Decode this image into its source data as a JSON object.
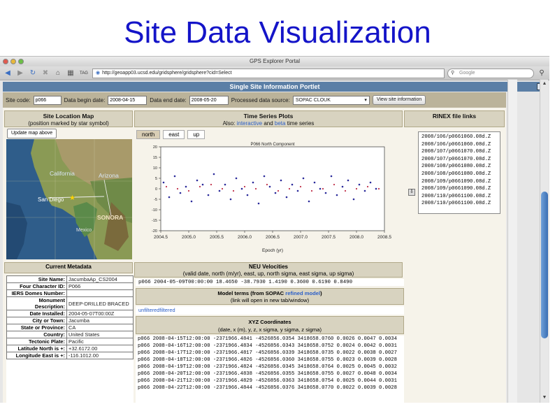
{
  "slide": {
    "title": "Site Data Visualization"
  },
  "browser": {
    "window_title": "GPS Explorer Portal",
    "url_prefix": "TAG",
    "url": "http://geoapp03.ucsd.edu/gridsphere/gridsphere?cid=Select",
    "search_placeholder": "Google"
  },
  "portlet": {
    "title": "Single Site Information Portlet"
  },
  "form": {
    "site_code_label": "Site code:",
    "site_code": "p066",
    "begin_label": "Data begin date:",
    "begin_date": "2008-04-15",
    "end_label": "Data end date:",
    "end_date": "2008-05-20",
    "source_label": "Processed data source:",
    "source": "SOPAC CLOUK",
    "view_button": "View site information"
  },
  "map_panel": {
    "title": "Site Location Map",
    "subtitle": "(position marked by star symbol)",
    "update_button": "Update map above",
    "labels": {
      "california": "California",
      "arizona": "Arizona",
      "san_diego": "San Diego",
      "sonora": "SONORA",
      "mexico": "Mexico"
    }
  },
  "ts_panel": {
    "title": "Time Series Plots",
    "also": "Also:",
    "interactive": "interactive",
    "and": "and",
    "beta": "beta",
    "time_series": "time series",
    "tabs": [
      "north",
      "east",
      "up"
    ]
  },
  "chart_data": {
    "type": "scatter",
    "x_ticks": [
      "2004.5",
      "2005.0",
      "2005.5",
      "2006.0",
      "2006.5",
      "2007.0",
      "2007.5",
      "2008.0",
      "2008.5"
    ],
    "y_ticks": [
      "20",
      "15",
      "10",
      "5",
      "0",
      "-5",
      "-10",
      "-15",
      "-20"
    ],
    "xlim": [
      2004.5,
      2008.5
    ],
    "ylim": [
      -20,
      20
    ],
    "title": "P066 North Component",
    "xlabel": "Epoch (yr)",
    "ylabel": "",
    "series": [
      {
        "color": "#2a2a9a",
        "x": [
          2004.55,
          2004.65,
          2004.75,
          2004.85,
          2004.95,
          2005.05,
          2005.15,
          2005.25,
          2005.35,
          2005.45,
          2005.55,
          2005.65,
          2005.75,
          2005.85,
          2005.95,
          2006.05,
          2006.15,
          2006.25,
          2006.35,
          2006.45,
          2006.55,
          2006.65,
          2006.75,
          2006.85,
          2006.95,
          2007.05,
          2007.15,
          2007.25,
          2007.35,
          2007.45,
          2007.55,
          2007.65,
          2007.75,
          2007.85,
          2007.95,
          2008.05,
          2008.15,
          2008.25,
          2008.35
        ],
        "y": [
          3,
          -4,
          6,
          -2,
          1,
          -6,
          4,
          2,
          -3,
          7,
          -1,
          2,
          -5,
          5,
          0,
          -3,
          3,
          -7,
          6,
          1,
          -2,
          4,
          -4,
          2,
          -1,
          5,
          -6,
          3,
          0,
          -2,
          6,
          -3,
          1,
          4,
          -5,
          2,
          -1,
          3,
          0
        ]
      },
      {
        "color": "#c0304a",
        "x": [
          2004.6,
          2004.8,
          2005.0,
          2005.2,
          2005.4,
          2005.6,
          2005.8,
          2006.0,
          2006.2,
          2006.4,
          2006.6,
          2006.8,
          2007.0,
          2007.2,
          2007.4,
          2007.6,
          2007.8,
          2008.0,
          2008.2,
          2008.4
        ],
        "y": [
          1,
          0,
          -1,
          1,
          2,
          0,
          -1,
          1,
          0,
          2,
          -1,
          0,
          1,
          -1,
          0,
          2,
          -1,
          0,
          1,
          0
        ]
      }
    ]
  },
  "rinex_panel": {
    "title": "RINEX file links",
    "files": [
      "2008/106/p0661060.08d.Z",
      "2008/106/p0661060.08d.Z",
      "2008/107/p0661070.08d.Z",
      "2008/107/p0661070.08d.Z",
      "2008/108/p0661080.08d.Z",
      "2008/108/p0661080.08d.Z",
      "2008/109/p0661090.08d.Z",
      "2008/109/p0661090.08d.Z",
      "2008/110/p0661100.08d.Z",
      "2008/110/p0661100.08d.Z"
    ]
  },
  "metadata": {
    "title": "Current Metadata",
    "rows": [
      {
        "k": "Site Name:",
        "v": "JacumbaAp_CS2004"
      },
      {
        "k": "Four Character ID:",
        "v": "P066"
      },
      {
        "k": "IERS Domes Number:",
        "v": ""
      },
      {
        "k": "Monument Description:",
        "v": "DEEP-DRILLED BRACED"
      },
      {
        "k": "Date Installed:",
        "v": "2004-05-07T00:00Z"
      },
      {
        "k": "City or Town:",
        "v": "Jacumba"
      },
      {
        "k": "State or Province:",
        "v": "CA"
      },
      {
        "k": "Country:",
        "v": "United States"
      },
      {
        "k": "Tectonic Plate:",
        "v": "Pacific"
      },
      {
        "k": "Latitude North is +:",
        "v": "+32.6172.00"
      },
      {
        "k": "Longitude East is +:",
        "v": "-116.1012.00"
      }
    ]
  },
  "neu": {
    "title": "NEU Velocities",
    "subtitle": "(valid date, north (m/yr), east, up, north sigma, east sigma, up sigma)",
    "line": "p066 2004-05-09T00:00:00 18.4650 -38.7930 1.4190 0.3600 0.6190 0.8490"
  },
  "model": {
    "title_prefix": "Model terms (from SOPAC",
    "title_link": "refined model",
    "title_suffix": ")",
    "subtitle": "(link will open in new tab/window)",
    "unfiltered": "unfiltered",
    "filtered": "filtered"
  },
  "xyz": {
    "title": "XYZ Coordinates",
    "subtitle": "(date, x (m), y, z, x sigma, y sigma, z sigma)",
    "lines": [
      "p066 2008-04-15T12:00:00 -2371966.4841 -4526856.0354 3418658.0760 0.0026 0.0047 0.0034",
      "p066 2008-04-16T12:00:00 -2371966.4834 -4526856.0343 3418658.0752 0.0024 0.0042 0.0031",
      "p066 2008-04-17T12:00:00 -2371966.4817 -4526856.0339 3418658.0735 0.0022 0.0038 0.0027",
      "p066 2008-04-18T12:00:00 -2371966.4826 -4526856.0360 3418658.0755 0.0023 0.0039 0.0028",
      "p066 2008-04-19T12:00:00 -2371966.4824 -4526856.0345 3418658.0764 0.0025 0.0045 0.0032",
      "p066 2008-04-20T12:00:00 -2371966.4838 -4526856.0355 3418658.0755 0.0027 0.0048 0.0034",
      "p066 2008-04-21T12:00:00 -2371966.4829 -4526856.0363 3418658.0754 0.0025 0.0044 0.0031",
      "p066 2008-04-22T12:00:00 -2371966.4844 -4526856.0376 3418658.0770 0.0022 0.0039 0.0028"
    ]
  }
}
